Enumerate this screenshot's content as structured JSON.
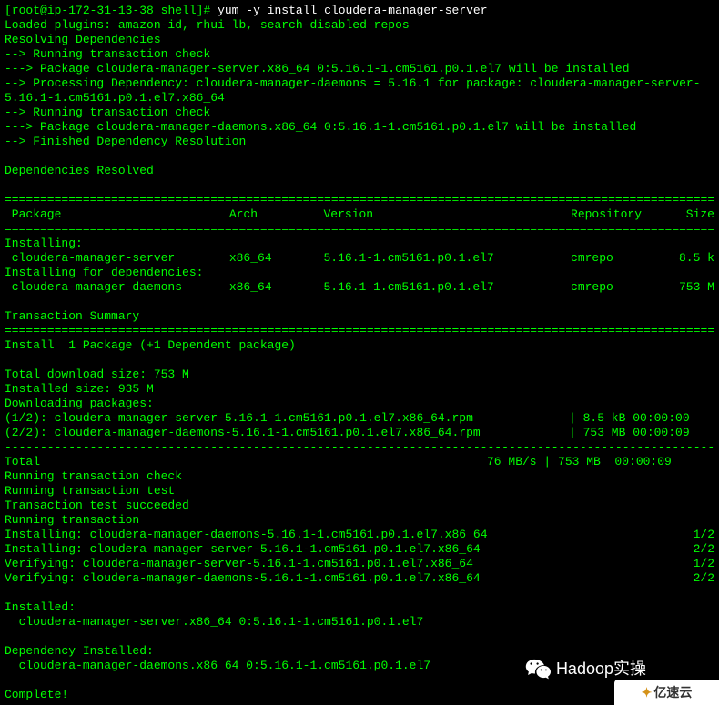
{
  "prompt": {
    "user_host": "root@ip-172-31-13-38",
    "cwd": "shell",
    "command": "yum -y install cloudera-manager-server"
  },
  "preamble": [
    "Loaded plugins: amazon-id, rhui-lb, search-disabled-repos",
    "Resolving Dependencies",
    "--> Running transaction check",
    "---> Package cloudera-manager-server.x86_64 0:5.16.1-1.cm5161.p0.1.el7 will be installed",
    "--> Processing Dependency: cloudera-manager-daemons = 5.16.1 for package: cloudera-manager-server-",
    "5.16.1-1.cm5161.p0.1.el7.x86_64",
    "--> Running transaction check",
    "---> Package cloudera-manager-daemons.x86_64 0:5.16.1-1.cm5161.p0.1.el7 will be installed",
    "--> Finished Dependency Resolution",
    "",
    "Dependencies Resolved"
  ],
  "hr_double": "================================================================================================================",
  "hr_single": "----------------------------------------------------------------------------------------------------------------",
  "table": {
    "headers": {
      "package": " Package",
      "arch": "Arch",
      "version": "Version",
      "repo": "Repository",
      "size": "Size"
    },
    "sections": [
      {
        "title": "Installing:",
        "rows": [
          {
            "package": " cloudera-manager-server",
            "arch": "x86_64",
            "version": "5.16.1-1.cm5161.p0.1.el7",
            "repo": "cmrepo",
            "size": "8.5 k"
          }
        ]
      },
      {
        "title": "Installing for dependencies:",
        "rows": [
          {
            "package": " cloudera-manager-daemons",
            "arch": "x86_64",
            "version": "5.16.1-1.cm5161.p0.1.el7",
            "repo": "cmrepo",
            "size": "753 M"
          }
        ]
      }
    ]
  },
  "summary_title": "Transaction Summary",
  "summary_line": "Install  1 Package (+1 Dependent package)",
  "totals": [
    "Total download size: 753 M",
    "Installed size: 935 M",
    "Downloading packages:"
  ],
  "downloads": [
    {
      "name": "(1/2): cloudera-manager-server-5.16.1-1.cm5161.p0.1.el7.x86_64.rpm",
      "size": "| 8.5 kB  00:00:00"
    },
    {
      "name": "(2/2): cloudera-manager-daemons-5.16.1-1.cm5161.p0.1.el7.x86_64.rpm",
      "size": "| 753 MB  00:00:09"
    }
  ],
  "total_line": {
    "left": "Total",
    "right": "76 MB/s | 753 MB  00:00:09"
  },
  "tx_steps": [
    "Running transaction check",
    "Running transaction test",
    "Transaction test succeeded",
    "Running transaction"
  ],
  "tx_actions": [
    {
      "action": "  Installing ",
      "pkg": ": cloudera-manager-daemons-5.16.1-1.cm5161.p0.1.el7.x86_64",
      "count": "1/2"
    },
    {
      "action": "  Installing ",
      "pkg": ": cloudera-manager-server-5.16.1-1.cm5161.p0.1.el7.x86_64",
      "count": "2/2"
    },
    {
      "action": "  Verifying  ",
      "pkg": ": cloudera-manager-server-5.16.1-1.cm5161.p0.1.el7.x86_64",
      "count": "1/2"
    },
    {
      "action": "  Verifying  ",
      "pkg": ": cloudera-manager-daemons-5.16.1-1.cm5161.p0.1.el7.x86_64",
      "count": "2/2"
    }
  ],
  "installed": {
    "title": "Installed:",
    "items": [
      "  cloudera-manager-server.x86_64 0:5.16.1-1.cm5161.p0.1.el7"
    ]
  },
  "dep_installed": {
    "title": "Dependency Installed:",
    "items": [
      "  cloudera-manager-daemons.x86_64 0:5.16.1-1.cm5161.p0.1.el7"
    ]
  },
  "complete": "Complete!",
  "watermark": "Hadoop实操",
  "corner": {
    "accent": "✦",
    "text": "亿速云"
  }
}
